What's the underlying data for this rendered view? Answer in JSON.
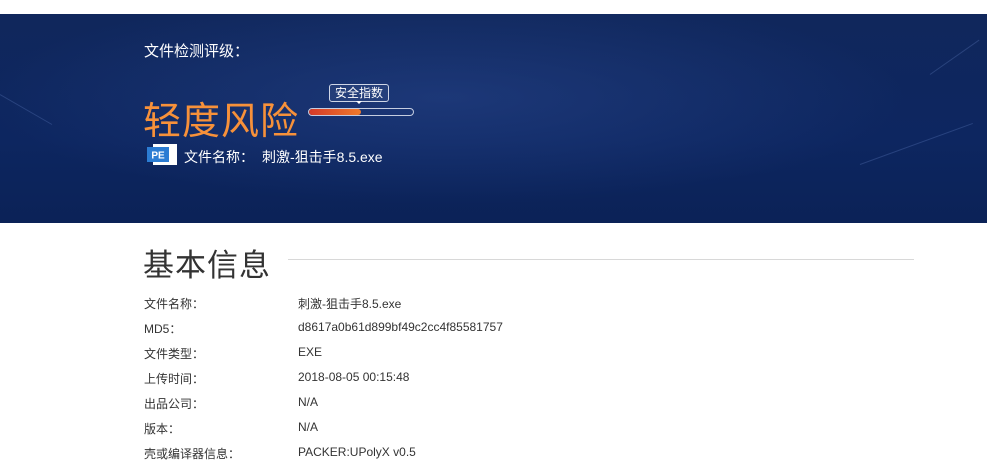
{
  "hero": {
    "grade_label": "文件检测评级：",
    "risk_level": "轻度风险",
    "meter_label": "安全指数",
    "meter_fill": 0.5,
    "file_icon": "pe-file-icon",
    "file_icon_text": "PE",
    "file_label": "文件名称：",
    "file_name": "刺激-狙击手8.5.exe"
  },
  "basic_info": {
    "title": "基本信息",
    "rows": [
      {
        "label": "文件名称：",
        "value": "刺激-狙击手8.5.exe"
      },
      {
        "label": "MD5：",
        "value": "d8617a0b61d899bf49c2cc4f85581757"
      },
      {
        "label": "文件类型：",
        "value": "EXE"
      },
      {
        "label": "上传时间：",
        "value": "2018-08-05 00:15:48"
      },
      {
        "label": "出品公司：",
        "value": "N/A"
      },
      {
        "label": "版本：",
        "value": "N/A"
      },
      {
        "label": "壳或编译器信息：",
        "value": "PACKER:UPolyX v0.5"
      }
    ]
  },
  "colors": {
    "hero_bg": "#0d2660",
    "risk_orange": "#f7913a",
    "meter_red": "#d33a2a"
  }
}
